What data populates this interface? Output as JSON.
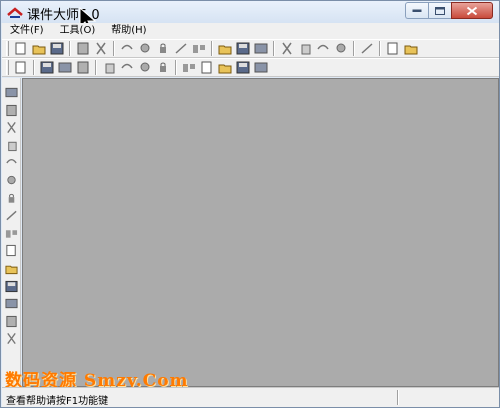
{
  "window": {
    "title": "课件大师5.0"
  },
  "menu": {
    "items": [
      "文件(F)",
      "工具(O)",
      "帮助(H)"
    ]
  },
  "toolbar1": {
    "icons": [
      "new-file-icon",
      "open-folder-icon",
      "save-icon",
      "sep",
      "save-as-icon",
      "print-icon",
      "sep",
      "cut-icon",
      "copy-icon",
      "paste-icon",
      "undo-icon",
      "delete-icon",
      "sep",
      "import-icon",
      "link-icon",
      "lock-icon",
      "sep",
      "properties-icon",
      "objects-icon",
      "group-icon",
      "grid-icon",
      "sep",
      "preview-icon",
      "sep",
      "pen-icon",
      "arrow-tool-icon"
    ]
  },
  "toolbar2": {
    "icons": [
      "page-icon",
      "sep",
      "frame-icon",
      "frame-alt-icon",
      "text-box-icon",
      "sep",
      "layer-front-icon",
      "layer-back-icon",
      "layer-up-icon",
      "layer-down-icon",
      "sep",
      "align-left-icon",
      "align-center-icon",
      "align-top-icon",
      "align-bottom-icon",
      "distribute-icon"
    ]
  },
  "left_tools": [
    "pointer-icon",
    "text-tool-icon",
    "text-cursor-icon",
    "picture-icon",
    "image-frame-icon",
    "film-icon",
    "sound-icon",
    "chart-icon",
    "input-field-icon",
    "rectangle-icon",
    "rotate-icon",
    "shapes-icon",
    "note-icon",
    "label-icon",
    "image-link-icon"
  ],
  "status": {
    "text": "查看帮助请按F1功能键"
  },
  "watermark": {
    "text": "数码资源 Smzy.Com"
  }
}
